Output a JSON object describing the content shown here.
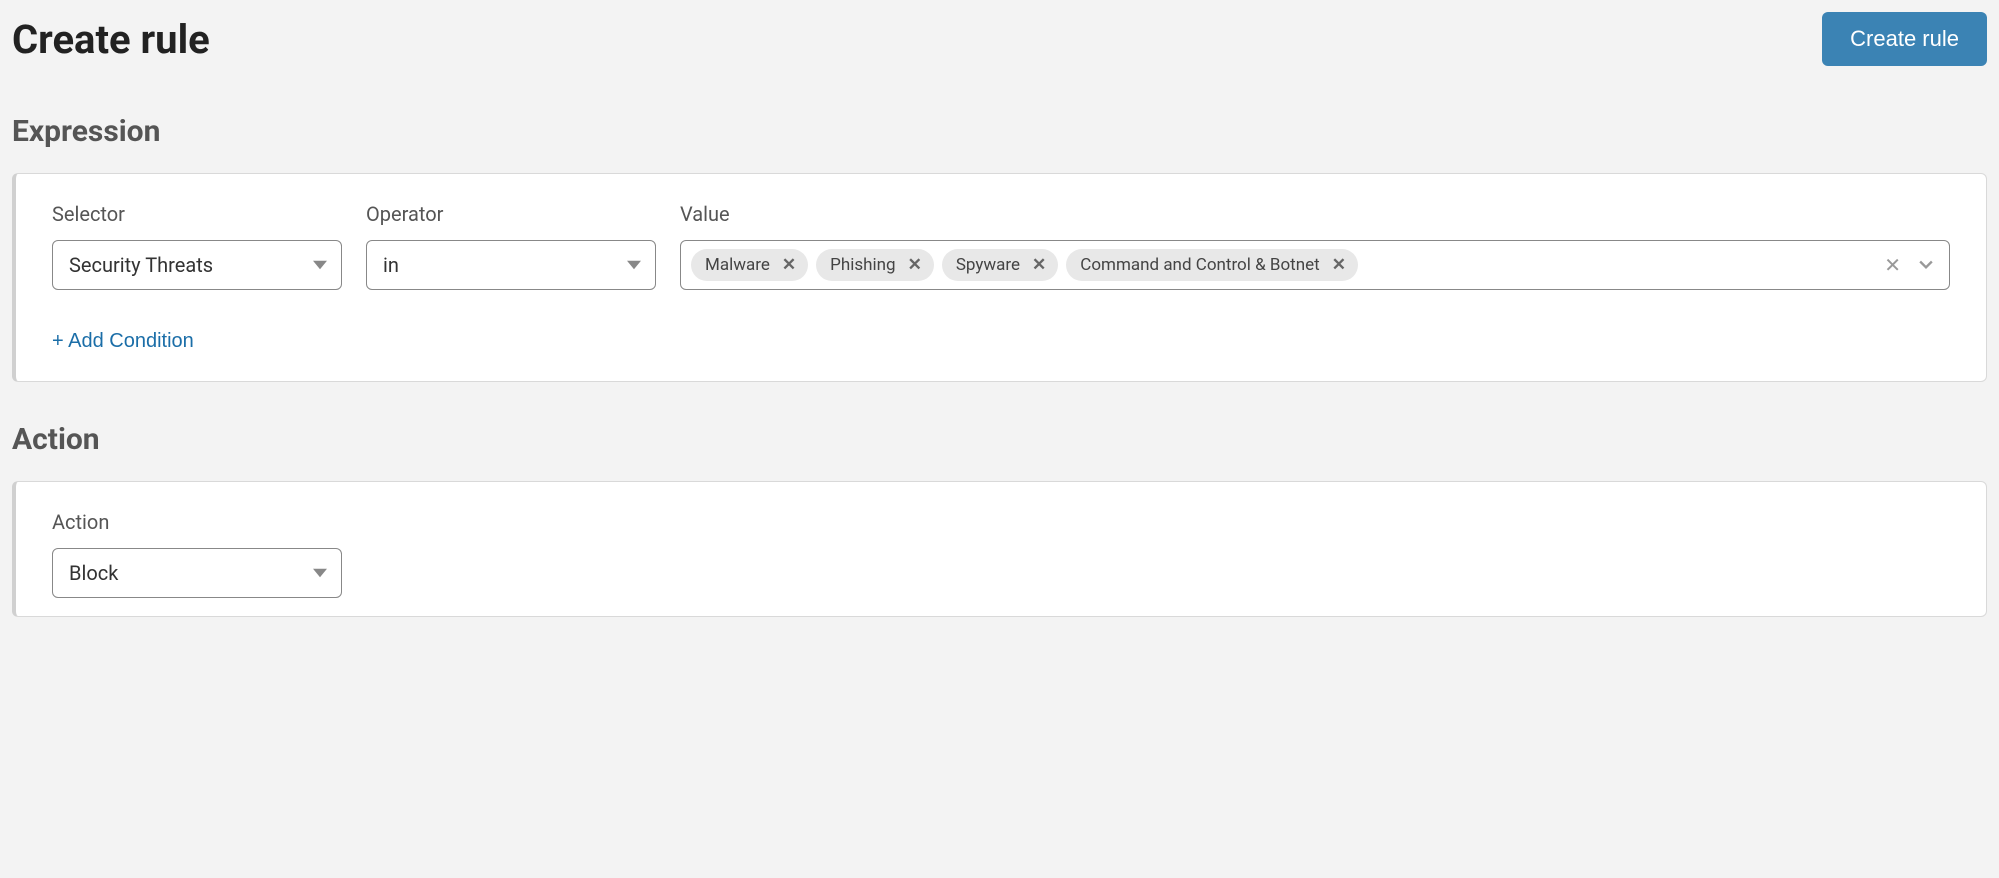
{
  "header": {
    "title": "Create rule",
    "create_button": "Create rule"
  },
  "sections": {
    "expression": {
      "title": "Expression",
      "labels": {
        "selector": "Selector",
        "operator": "Operator",
        "value": "Value"
      },
      "selector_value": "Security Threats",
      "operator_value": "in",
      "value_chips": [
        "Malware",
        "Phishing",
        "Spyware",
        "Command and Control & Botnet"
      ],
      "add_condition": "+ Add Condition"
    },
    "action": {
      "title": "Action",
      "label": "Action",
      "value": "Block"
    }
  }
}
